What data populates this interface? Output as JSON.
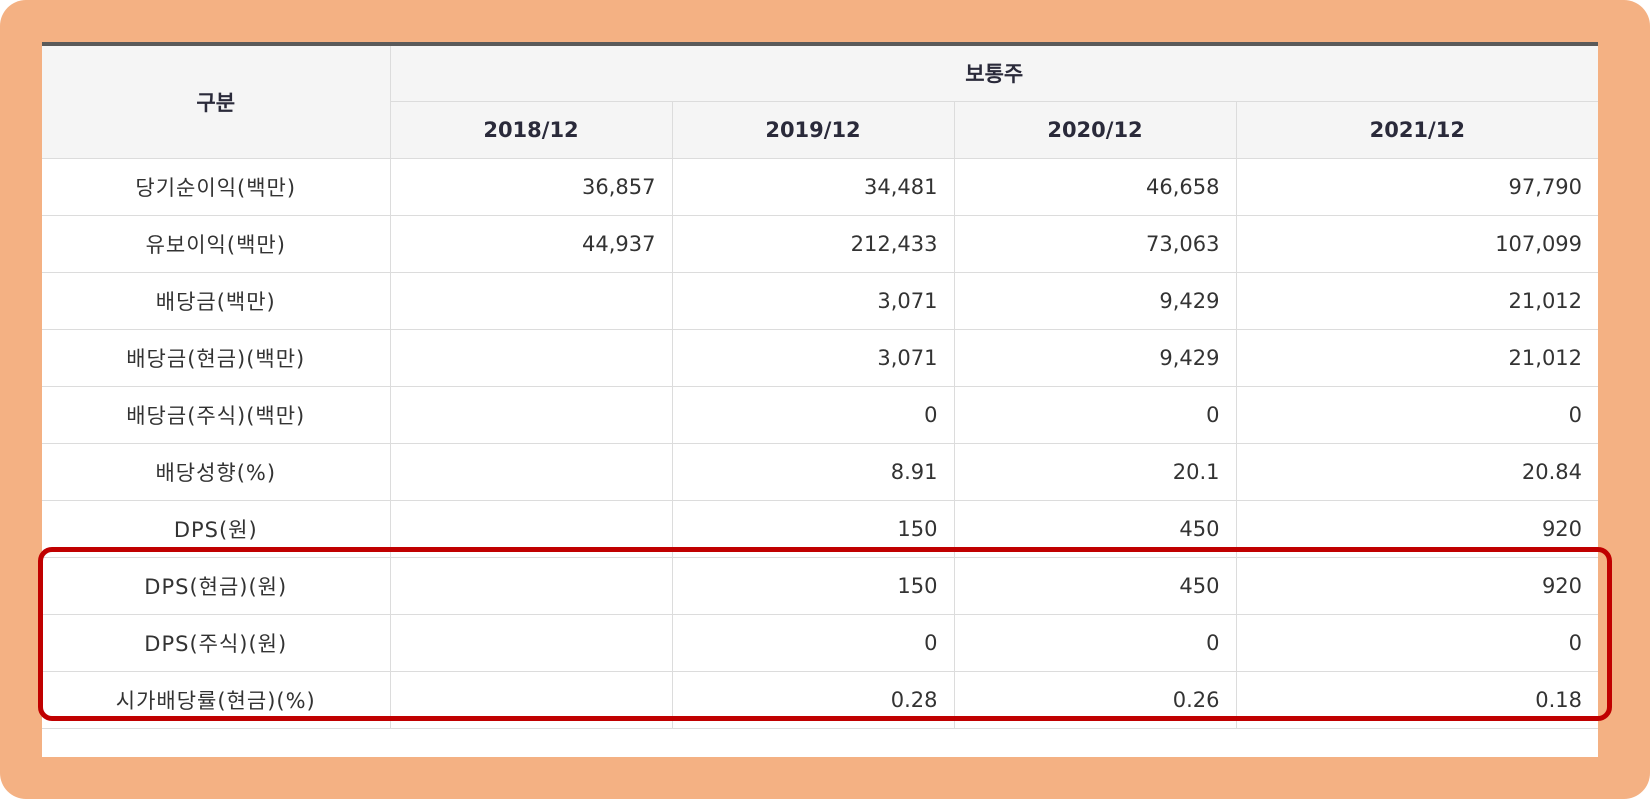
{
  "table": {
    "header": {
      "category": "구분",
      "group": "보통주",
      "years": [
        "2018/12",
        "2019/12",
        "2020/12",
        "2021/12"
      ]
    },
    "rows": [
      {
        "label": "당기순이익(백만)",
        "values": [
          "36,857",
          "34,481",
          "46,658",
          "97,790"
        ]
      },
      {
        "label": "유보이익(백만)",
        "values": [
          "44,937",
          "212,433",
          "73,063",
          "107,099"
        ]
      },
      {
        "label": "배당금(백만)",
        "values": [
          "",
          "3,071",
          "9,429",
          "21,012"
        ]
      },
      {
        "label": "배당금(현금)(백만)",
        "values": [
          "",
          "3,071",
          "9,429",
          "21,012"
        ]
      },
      {
        "label": "배당금(주식)(백만)",
        "values": [
          "",
          "0",
          "0",
          "0"
        ]
      },
      {
        "label": "배당성향(%)",
        "values": [
          "",
          "8.91",
          "20.1",
          "20.84"
        ]
      },
      {
        "label": "DPS(원)",
        "values": [
          "",
          "150",
          "450",
          "920"
        ]
      },
      {
        "label": "DPS(현금)(원)",
        "values": [
          "",
          "150",
          "450",
          "920"
        ]
      },
      {
        "label": "DPS(주식)(원)",
        "values": [
          "",
          "0",
          "0",
          "0"
        ]
      },
      {
        "label": "시가배당률(현금)(%)",
        "values": [
          "",
          "0.28",
          "0.26",
          "0.18"
        ]
      }
    ]
  },
  "colors": {
    "frame": "#f4b183",
    "highlight": "#c00000",
    "header_bg": "#f5f5f5",
    "top_rule": "#5a5a5a"
  }
}
